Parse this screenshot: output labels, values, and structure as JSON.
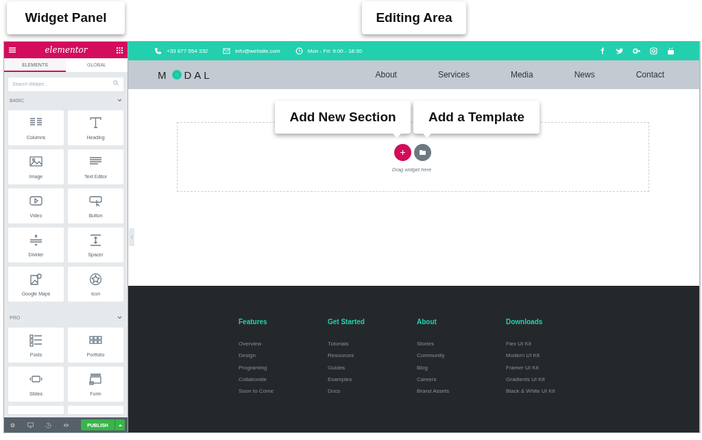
{
  "callouts": [
    {
      "text": "Widget Panel"
    },
    {
      "text": "Editing Area"
    },
    {
      "text": "Add New Section"
    },
    {
      "text": "Add a Template"
    }
  ],
  "panel": {
    "logo": "elementor",
    "tabs": [
      {
        "label": "ELEMENTS",
        "selected": true
      },
      {
        "label": "GLOBAL",
        "selected": false
      }
    ],
    "search": {
      "placeholder": "Search Widget..."
    },
    "categories": [
      {
        "title": "BASIC",
        "widgets": [
          {
            "label": "Columns"
          },
          {
            "label": "Heading"
          },
          {
            "label": "Image"
          },
          {
            "label": "Text Editor"
          },
          {
            "label": "Video"
          },
          {
            "label": "Button"
          },
          {
            "label": "Divider"
          },
          {
            "label": "Spacer"
          },
          {
            "label": "Google Maps"
          },
          {
            "label": "Icon"
          }
        ]
      },
      {
        "title": "PRO",
        "widgets": [
          {
            "label": "Posts"
          },
          {
            "label": "Portfolio"
          },
          {
            "label": "Slides"
          },
          {
            "label": "Form"
          },
          {
            "cut": true
          },
          {
            "cut": true
          }
        ]
      }
    ],
    "publish": "PUBLISH"
  },
  "site": {
    "topbar": [
      {
        "kind": "phone",
        "text": "+33 877 554 332"
      },
      {
        "kind": "mail",
        "text": "info@website.com"
      },
      {
        "kind": "clock",
        "text": "Mon - Fri: 9:00 - 18:30"
      }
    ],
    "logo": {
      "first": "M",
      "rest": "DAL"
    },
    "nav": [
      "About",
      "Services",
      "Media",
      "News",
      "Contact"
    ],
    "drop_hint": "Drag widget here",
    "footer": [
      {
        "title": "Features",
        "links": [
          "Overview",
          "Design",
          "Programing",
          "Collaborate",
          "Soon to Come"
        ]
      },
      {
        "title": "Get Started",
        "links": [
          "Tutorials",
          "Resources",
          "Guides",
          "Examples",
          "Docs"
        ]
      },
      {
        "title": "About",
        "links": [
          "Stories",
          "Community",
          "Blog",
          "Careers",
          "Brand Assets"
        ]
      },
      {
        "title": "Downloads",
        "links": [
          "Flex UI Kit",
          "Modern UI Kit",
          "Framer UI Kit",
          "Gradients UI Kit",
          "Black & White UI Kit"
        ]
      }
    ]
  }
}
